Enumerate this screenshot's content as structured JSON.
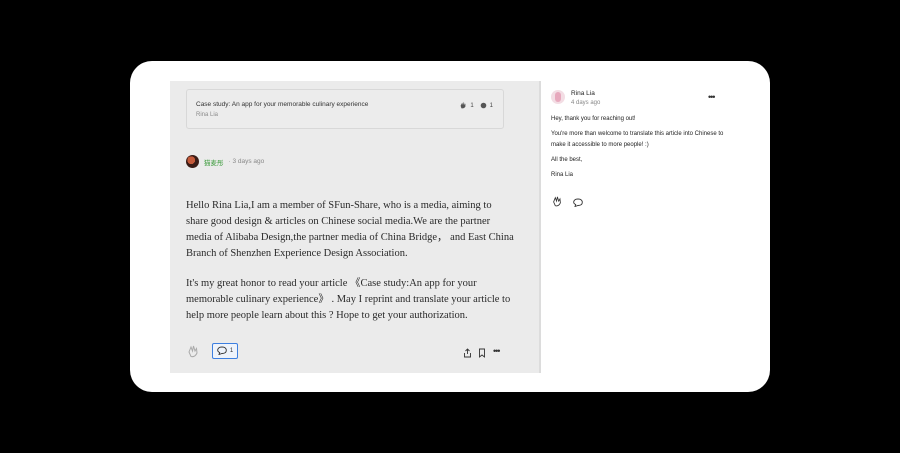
{
  "quote_card": {
    "title": "Case study: An app for your memorable culinary experience",
    "author": "Rina Lia",
    "claps": "1",
    "responses": "1"
  },
  "response": {
    "author": "猫麦彤",
    "date": "· 3 days ago",
    "paragraphs": [
      "Hello Rina Lia,I am a member of SFun-Share, who is a media, aiming to share good design & articles on Chinese social media.We are the partner media of Alibaba Design,the partner media of China Bridge，  and East China Branch of Shenzhen Experience Design Association.",
      "It's my great honor to read your article 《Case study:An app for your memorable culinary experience》 . May I reprint and translate your article to help more people learn about this ? Hope to get your authorization."
    ],
    "reply_count": "1"
  },
  "reply": {
    "author": "Rina Lia",
    "date": "4 days ago",
    "lines": [
      "Hey, thank you for reaching out!",
      "You're more than welcome to translate this article into Chinese to make it accessible to more people! :)",
      "All the best,",
      "Rina Lia"
    ]
  },
  "colors": {
    "accent": "#3d7fe0",
    "author_name": "#3a9a3a",
    "panel_bg": "#ebebeb",
    "backdrop": "#000000"
  }
}
